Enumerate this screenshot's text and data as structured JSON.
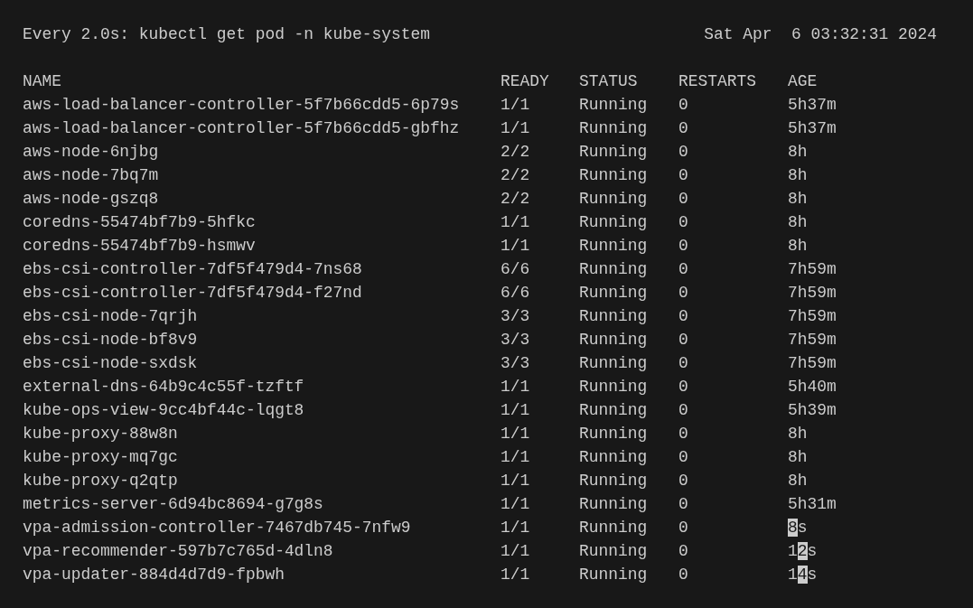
{
  "header": {
    "command": "Every 2.0s: kubectl get pod -n kube-system",
    "timestamp": "Sat Apr  6 03:32:31 2024"
  },
  "table": {
    "columns": [
      "NAME",
      "READY",
      "STATUS",
      "RESTARTS",
      "AGE"
    ],
    "rows": [
      {
        "name": "aws-load-balancer-controller-5f7b66cdd5-6p79s",
        "ready": "1/1",
        "status": "Running",
        "restarts": "0",
        "age": [
          {
            "text": "5h37m",
            "changed": false
          }
        ]
      },
      {
        "name": "aws-load-balancer-controller-5f7b66cdd5-gbfhz",
        "ready": "1/1",
        "status": "Running",
        "restarts": "0",
        "age": [
          {
            "text": "5h37m",
            "changed": false
          }
        ]
      },
      {
        "name": "aws-node-6njbg",
        "ready": "2/2",
        "status": "Running",
        "restarts": "0",
        "age": [
          {
            "text": "8h",
            "changed": false
          }
        ]
      },
      {
        "name": "aws-node-7bq7m",
        "ready": "2/2",
        "status": "Running",
        "restarts": "0",
        "age": [
          {
            "text": "8h",
            "changed": false
          }
        ]
      },
      {
        "name": "aws-node-gszq8",
        "ready": "2/2",
        "status": "Running",
        "restarts": "0",
        "age": [
          {
            "text": "8h",
            "changed": false
          }
        ]
      },
      {
        "name": "coredns-55474bf7b9-5hfkc",
        "ready": "1/1",
        "status": "Running",
        "restarts": "0",
        "age": [
          {
            "text": "8h",
            "changed": false
          }
        ]
      },
      {
        "name": "coredns-55474bf7b9-hsmwv",
        "ready": "1/1",
        "status": "Running",
        "restarts": "0",
        "age": [
          {
            "text": "8h",
            "changed": false
          }
        ]
      },
      {
        "name": "ebs-csi-controller-7df5f479d4-7ns68",
        "ready": "6/6",
        "status": "Running",
        "restarts": "0",
        "age": [
          {
            "text": "7h59m",
            "changed": false
          }
        ]
      },
      {
        "name": "ebs-csi-controller-7df5f479d4-f27nd",
        "ready": "6/6",
        "status": "Running",
        "restarts": "0",
        "age": [
          {
            "text": "7h59m",
            "changed": false
          }
        ]
      },
      {
        "name": "ebs-csi-node-7qrjh",
        "ready": "3/3",
        "status": "Running",
        "restarts": "0",
        "age": [
          {
            "text": "7h59m",
            "changed": false
          }
        ]
      },
      {
        "name": "ebs-csi-node-bf8v9",
        "ready": "3/3",
        "status": "Running",
        "restarts": "0",
        "age": [
          {
            "text": "7h59m",
            "changed": false
          }
        ]
      },
      {
        "name": "ebs-csi-node-sxdsk",
        "ready": "3/3",
        "status": "Running",
        "restarts": "0",
        "age": [
          {
            "text": "7h59m",
            "changed": false
          }
        ]
      },
      {
        "name": "external-dns-64b9c4c55f-tzftf",
        "ready": "1/1",
        "status": "Running",
        "restarts": "0",
        "age": [
          {
            "text": "5h40m",
            "changed": false
          }
        ]
      },
      {
        "name": "kube-ops-view-9cc4bf44c-lqgt8",
        "ready": "1/1",
        "status": "Running",
        "restarts": "0",
        "age": [
          {
            "text": "5h39m",
            "changed": false
          }
        ]
      },
      {
        "name": "kube-proxy-88w8n",
        "ready": "1/1",
        "status": "Running",
        "restarts": "0",
        "age": [
          {
            "text": "8h",
            "changed": false
          }
        ]
      },
      {
        "name": "kube-proxy-mq7gc",
        "ready": "1/1",
        "status": "Running",
        "restarts": "0",
        "age": [
          {
            "text": "8h",
            "changed": false
          }
        ]
      },
      {
        "name": "kube-proxy-q2qtp",
        "ready": "1/1",
        "status": "Running",
        "restarts": "0",
        "age": [
          {
            "text": "8h",
            "changed": false
          }
        ]
      },
      {
        "name": "metrics-server-6d94bc8694-g7g8s",
        "ready": "1/1",
        "status": "Running",
        "restarts": "0",
        "age": [
          {
            "text": "5h31m",
            "changed": false
          }
        ]
      },
      {
        "name": "vpa-admission-controller-7467db745-7nfw9",
        "ready": "1/1",
        "status": "Running",
        "restarts": "0",
        "age": [
          {
            "text": "8",
            "changed": true
          },
          {
            "text": "s",
            "changed": false
          }
        ]
      },
      {
        "name": "vpa-recommender-597b7c765d-4dln8",
        "ready": "1/1",
        "status": "Running",
        "restarts": "0",
        "age": [
          {
            "text": "1",
            "changed": false
          },
          {
            "text": "2",
            "changed": true
          },
          {
            "text": "s",
            "changed": false
          }
        ]
      },
      {
        "name": "vpa-updater-884d4d7d9-fpbwh",
        "ready": "1/1",
        "status": "Running",
        "restarts": "0",
        "age": [
          {
            "text": "1",
            "changed": false
          },
          {
            "text": "4",
            "changed": true
          },
          {
            "text": "s",
            "changed": false
          }
        ]
      }
    ]
  }
}
